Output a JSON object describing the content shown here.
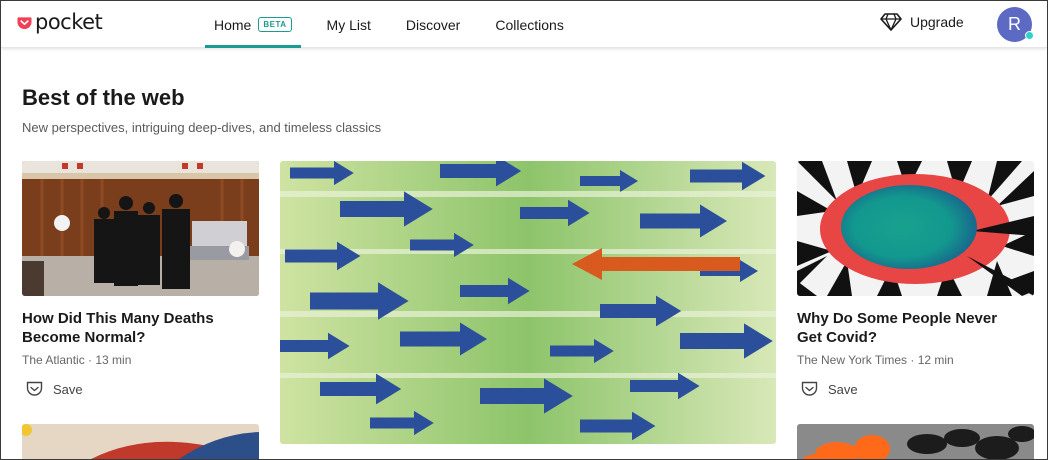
{
  "logo": {
    "text": "pocket"
  },
  "nav": {
    "items": [
      {
        "label": "Home",
        "badge": "BETA",
        "active": true
      },
      {
        "label": "My List"
      },
      {
        "label": "Discover"
      },
      {
        "label": "Collections"
      }
    ]
  },
  "header": {
    "upgrade_label": "Upgrade",
    "avatar_initial": "R"
  },
  "section": {
    "title": "Best of the web",
    "subtitle": "New perspectives, intriguing deep-dives, and timeless classics"
  },
  "cards": [
    {
      "title_line1": "How Did This Many Deaths",
      "title_line2": "Become Normal?",
      "source": "The Atlantic · 13 min",
      "save_label": "Save"
    },
    {
      "title_line1": "Why Do Some People Never",
      "title_line2": "Get Covid?",
      "source": "The New York Times · 12 min",
      "save_label": "Save"
    }
  ],
  "colors": {
    "accent": "#1a9a90",
    "pocket_red": "#ef4056",
    "avatar": "#5c6ac4"
  }
}
